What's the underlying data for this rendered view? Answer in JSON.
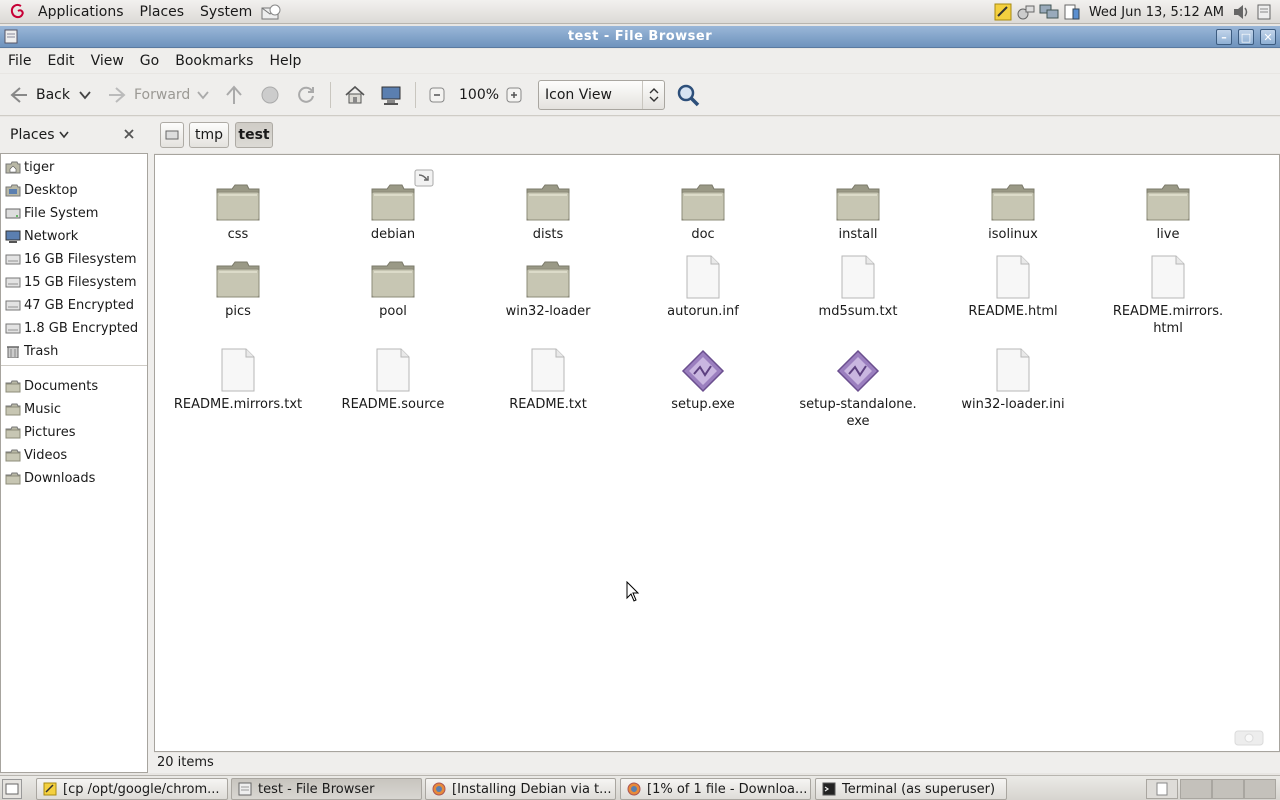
{
  "top_panel": {
    "menus": [
      "Applications",
      "Places",
      "System"
    ],
    "clock": "Wed Jun 13,  5:12 AM"
  },
  "window": {
    "title": "test - File Browser"
  },
  "menubar": {
    "items": [
      "File",
      "Edit",
      "View",
      "Go",
      "Bookmarks",
      "Help"
    ]
  },
  "toolbar": {
    "back_label": "Back",
    "forward_label": "Forward",
    "zoom_level": "100%",
    "view_mode": "Icon View"
  },
  "sidebar": {
    "header": "Places",
    "items": [
      {
        "label": "tiger",
        "icon": "home-folder-icon"
      },
      {
        "label": "Desktop",
        "icon": "desktop-folder-icon"
      },
      {
        "label": "File System",
        "icon": "filesystem-icon"
      },
      {
        "label": "Network",
        "icon": "network-icon"
      },
      {
        "label": "16 GB Filesystem",
        "icon": "drive-icon"
      },
      {
        "label": "15 GB Filesystem",
        "icon": "drive-icon"
      },
      {
        "label": "47 GB Encrypted",
        "icon": "drive-icon"
      },
      {
        "label": "1.8 GB Encrypted",
        "icon": "drive-icon"
      },
      {
        "label": "Trash",
        "icon": "trash-icon"
      }
    ],
    "bookmarks": [
      {
        "label": "Documents",
        "icon": "folder-icon"
      },
      {
        "label": "Music",
        "icon": "folder-icon"
      },
      {
        "label": "Pictures",
        "icon": "folder-icon"
      },
      {
        "label": "Videos",
        "icon": "folder-icon"
      },
      {
        "label": "Downloads",
        "icon": "folder-icon"
      }
    ]
  },
  "pathbar": {
    "crumbs": [
      "tmp",
      "test"
    ]
  },
  "files": [
    {
      "name": "css",
      "type": "folder"
    },
    {
      "name": "debian",
      "type": "folder-link"
    },
    {
      "name": "dists",
      "type": "folder"
    },
    {
      "name": "doc",
      "type": "folder"
    },
    {
      "name": "install",
      "type": "folder"
    },
    {
      "name": "isolinux",
      "type": "folder"
    },
    {
      "name": "live",
      "type": "folder"
    },
    {
      "name": "pics",
      "type": "folder"
    },
    {
      "name": "pool",
      "type": "folder"
    },
    {
      "name": "win32-loader",
      "type": "folder"
    },
    {
      "name": "autorun.inf",
      "type": "file"
    },
    {
      "name": "md5sum.txt",
      "type": "file"
    },
    {
      "name": "README.html",
      "type": "file"
    },
    {
      "name": "README.mirrors.\nhtml",
      "type": "file"
    },
    {
      "name": "README.mirrors.txt",
      "type": "file"
    },
    {
      "name": "README.source",
      "type": "file"
    },
    {
      "name": "README.txt",
      "type": "file"
    },
    {
      "name": "setup.exe",
      "type": "exe"
    },
    {
      "name": "setup-standalone.\nexe",
      "type": "exe"
    },
    {
      "name": "win32-loader.ini",
      "type": "file"
    }
  ],
  "status": {
    "item_count": "20 items"
  },
  "taskbar": {
    "tasks": [
      {
        "label": "[cp /opt/google/chrom...",
        "icon": "text-editor-icon"
      },
      {
        "label": "test - File Browser",
        "icon": "file-manager-icon"
      },
      {
        "label": "[Installing Debian via t...",
        "icon": "browser-icon"
      },
      {
        "label": "[1% of 1 file - Downloa...",
        "icon": "browser-icon"
      },
      {
        "label": "Terminal (as superuser)",
        "icon": "terminal-icon"
      }
    ]
  },
  "colors": {
    "titlebar": "#7a9cc4",
    "folder": "#b9b8a6",
    "exe": "#8d6fb0"
  }
}
